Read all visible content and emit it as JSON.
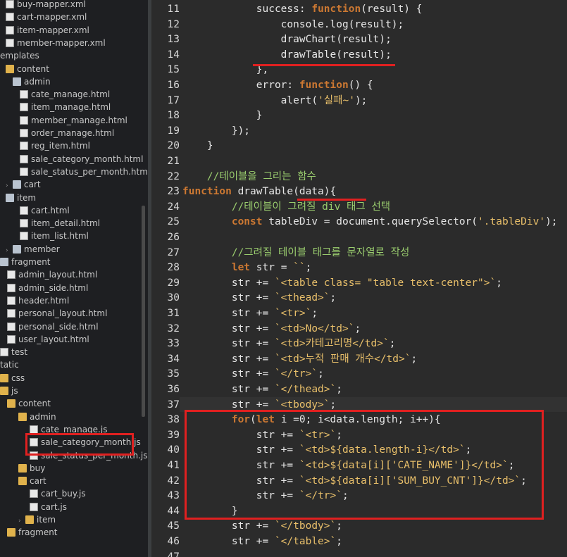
{
  "explorer": {
    "items": [
      {
        "label": "buy-mapper.xml",
        "indent": 8,
        "type": "file"
      },
      {
        "label": "cart-mapper.xml",
        "indent": 8,
        "type": "file"
      },
      {
        "label": "item-mapper.xml",
        "indent": 8,
        "type": "file"
      },
      {
        "label": "member-mapper.xml",
        "indent": 8,
        "type": "file"
      },
      {
        "label": "emplates",
        "indent": 0,
        "type": "none"
      },
      {
        "label": "content",
        "indent": 8,
        "type": "folder"
      },
      {
        "label": "admin",
        "indent": 18,
        "type": "pkg"
      },
      {
        "label": "cate_manage.html",
        "indent": 28,
        "type": "file"
      },
      {
        "label": "item_manage.html",
        "indent": 28,
        "type": "file"
      },
      {
        "label": "member_manage.html",
        "indent": 28,
        "type": "file"
      },
      {
        "label": "order_manage.html",
        "indent": 28,
        "type": "file"
      },
      {
        "label": "reg_item.html",
        "indent": 28,
        "type": "file"
      },
      {
        "label": "sale_category_month.html",
        "indent": 28,
        "type": "file"
      },
      {
        "label": "sale_status_per_month.html",
        "indent": 28,
        "type": "file"
      },
      {
        "label": "cart",
        "indent": 8,
        "type": "pkg",
        "twisty": "›"
      },
      {
        "label": "item",
        "indent": 8,
        "type": "pkg"
      },
      {
        "label": "cart.html",
        "indent": 28,
        "type": "file"
      },
      {
        "label": "item_detail.html",
        "indent": 28,
        "type": "file"
      },
      {
        "label": "item_list.html",
        "indent": 28,
        "type": "file"
      },
      {
        "label": "member",
        "indent": 8,
        "type": "pkg",
        "twisty": "›"
      },
      {
        "label": "fragment",
        "indent": 0,
        "type": "pkg"
      },
      {
        "label": "admin_layout.html",
        "indent": 10,
        "type": "file"
      },
      {
        "label": "admin_side.html",
        "indent": 10,
        "type": "file"
      },
      {
        "label": "header.html",
        "indent": 10,
        "type": "file"
      },
      {
        "label": "personal_layout.html",
        "indent": 10,
        "type": "file"
      },
      {
        "label": "personal_side.html",
        "indent": 10,
        "type": "file"
      },
      {
        "label": "user_layout.html",
        "indent": 10,
        "type": "file"
      },
      {
        "label": "test",
        "indent": 0,
        "type": "file"
      },
      {
        "label": "tatic",
        "indent": 0,
        "type": "none"
      },
      {
        "label": "css",
        "indent": 0,
        "type": "folder"
      },
      {
        "label": "js",
        "indent": 0,
        "type": "folder"
      },
      {
        "label": "content",
        "indent": 10,
        "type": "folder"
      },
      {
        "label": "admin",
        "indent": 26,
        "type": "folder"
      },
      {
        "label": "cate_manage.js",
        "indent": 42,
        "type": "file"
      },
      {
        "label": "sale_category_month.js",
        "indent": 42,
        "type": "file"
      },
      {
        "label": "sale_status_per_month.js",
        "indent": 42,
        "type": "file"
      },
      {
        "label": "buy",
        "indent": 26,
        "type": "folder"
      },
      {
        "label": "cart",
        "indent": 26,
        "type": "folder"
      },
      {
        "label": "cart_buy.js",
        "indent": 42,
        "type": "file"
      },
      {
        "label": "cart.js",
        "indent": 42,
        "type": "file"
      },
      {
        "label": "item",
        "indent": 26,
        "type": "folder",
        "twisty": "›"
      },
      {
        "label": "fragment",
        "indent": 10,
        "type": "folder"
      }
    ]
  },
  "editor": {
    "lines": [
      {
        "n": "11",
        "code": [
          [
            "            ",
            ""
          ],
          [
            "success",
            ""
          ],
          [
            ": ",
            ""
          ],
          [
            "function",
            "kw"
          ],
          [
            "(result) {",
            ""
          ]
        ]
      },
      {
        "n": "12",
        "code": [
          [
            "                console.log(result);",
            ""
          ]
        ]
      },
      {
        "n": "13",
        "code": [
          [
            "                drawChart(result);",
            ""
          ]
        ]
      },
      {
        "n": "14",
        "code": [
          [
            "                drawTable(result);",
            ""
          ]
        ]
      },
      {
        "n": "15",
        "code": [
          [
            "            },",
            ""
          ]
        ]
      },
      {
        "n": "16",
        "code": [
          [
            "            error: ",
            ""
          ],
          [
            "function",
            "kw"
          ],
          [
            "() {",
            ""
          ]
        ]
      },
      {
        "n": "17",
        "code": [
          [
            "                alert(",
            ""
          ],
          [
            "'실패~'",
            "st"
          ],
          [
            ");",
            ""
          ]
        ]
      },
      {
        "n": "18",
        "code": [
          [
            "            }",
            ""
          ]
        ]
      },
      {
        "n": "19",
        "code": [
          [
            "        });",
            ""
          ]
        ]
      },
      {
        "n": "20",
        "code": [
          [
            "    }",
            ""
          ]
        ]
      },
      {
        "n": "21",
        "code": [
          [
            "",
            ""
          ]
        ]
      },
      {
        "n": "22",
        "code": [
          [
            "    //테이블을 그리는 함수",
            "cm"
          ]
        ]
      },
      {
        "n": "23",
        "code": [
          [
            "function",
            "kw"
          ],
          [
            " drawTable(data){",
            ""
          ]
        ]
      },
      {
        "n": "24",
        "code": [
          [
            "        //테이블이 그려질 div 태그 선택",
            "cm"
          ]
        ]
      },
      {
        "n": "25",
        "code": [
          [
            "        ",
            ""
          ],
          [
            "const",
            "kw"
          ],
          [
            " tableDiv = document.querySelector(",
            ""
          ],
          [
            "'.tableDiv'",
            "st"
          ],
          [
            ");",
            ""
          ]
        ]
      },
      {
        "n": "26",
        "code": [
          [
            "",
            ""
          ]
        ]
      },
      {
        "n": "27",
        "code": [
          [
            "        //그려질 테이블 태그를 문자열로 작성",
            "cm"
          ]
        ]
      },
      {
        "n": "28",
        "code": [
          [
            "        ",
            ""
          ],
          [
            "let",
            "kw"
          ],
          [
            " str = ",
            ""
          ],
          [
            "``",
            "st"
          ],
          [
            ";",
            ""
          ]
        ]
      },
      {
        "n": "29",
        "code": [
          [
            "        str += ",
            ""
          ],
          [
            "`<table class= \"table text-center\">`",
            "st"
          ],
          [
            ";",
            ""
          ]
        ]
      },
      {
        "n": "30",
        "code": [
          [
            "        str += ",
            ""
          ],
          [
            "`<thead>`",
            "st"
          ],
          [
            ";",
            ""
          ]
        ]
      },
      {
        "n": "31",
        "code": [
          [
            "        str += ",
            ""
          ],
          [
            "`<tr>`",
            "st"
          ],
          [
            ";",
            ""
          ]
        ]
      },
      {
        "n": "32",
        "code": [
          [
            "        str += ",
            ""
          ],
          [
            "`<td>No</td>`",
            "st"
          ],
          [
            ";",
            ""
          ]
        ]
      },
      {
        "n": "33",
        "code": [
          [
            "        str += ",
            ""
          ],
          [
            "`<td>카테고리명</td>`",
            "st"
          ],
          [
            ";",
            ""
          ]
        ]
      },
      {
        "n": "34",
        "code": [
          [
            "        str += ",
            ""
          ],
          [
            "`<td>누적 판매 개수</td>`",
            "st"
          ],
          [
            ";",
            ""
          ]
        ]
      },
      {
        "n": "35",
        "code": [
          [
            "        str += ",
            ""
          ],
          [
            "`</tr>`",
            "st"
          ],
          [
            ";",
            ""
          ]
        ]
      },
      {
        "n": "36",
        "code": [
          [
            "        str += ",
            ""
          ],
          [
            "`</thead>`",
            "st"
          ],
          [
            ";",
            ""
          ]
        ]
      },
      {
        "n": "37",
        "code": [
          [
            "        str += ",
            ""
          ],
          [
            "`<tbody>`",
            "st"
          ],
          [
            ";",
            ""
          ]
        ]
      },
      {
        "n": "38",
        "code": [
          [
            "        ",
            ""
          ],
          [
            "for",
            "kw"
          ],
          [
            "(",
            ""
          ],
          [
            "let",
            "kw"
          ],
          [
            " i =0; i<data.length; i++){",
            ""
          ]
        ]
      },
      {
        "n": "39",
        "code": [
          [
            "            str += ",
            ""
          ],
          [
            "`<tr>`",
            "st"
          ],
          [
            ";",
            ""
          ]
        ]
      },
      {
        "n": "40",
        "code": [
          [
            "            str += ",
            ""
          ],
          [
            "`<td>${data.length-i}</td>`",
            "st"
          ],
          [
            ";",
            ""
          ]
        ]
      },
      {
        "n": "41",
        "code": [
          [
            "            str += ",
            ""
          ],
          [
            "`<td>${data[i]['CATE_NAME']}</td>`",
            "st"
          ],
          [
            ";",
            ""
          ]
        ]
      },
      {
        "n": "42",
        "code": [
          [
            "            str += ",
            ""
          ],
          [
            "`<td>${data[i]['SUM_BUY_CNT']}</td>`",
            "st"
          ],
          [
            ";",
            ""
          ]
        ]
      },
      {
        "n": "43",
        "code": [
          [
            "            str += ",
            ""
          ],
          [
            "`</tr>`",
            "st"
          ],
          [
            ";",
            ""
          ]
        ]
      },
      {
        "n": "44",
        "code": [
          [
            "        }",
            ""
          ]
        ]
      },
      {
        "n": "45",
        "code": [
          [
            "        str += ",
            ""
          ],
          [
            "`</tbody>`",
            "st"
          ],
          [
            ";",
            ""
          ]
        ]
      },
      {
        "n": "46",
        "code": [
          [
            "        str += ",
            ""
          ],
          [
            "`</table>`",
            "st"
          ],
          [
            ";",
            ""
          ]
        ]
      },
      {
        "n": "47",
        "code": [
          [
            "",
            ""
          ]
        ]
      }
    ]
  }
}
